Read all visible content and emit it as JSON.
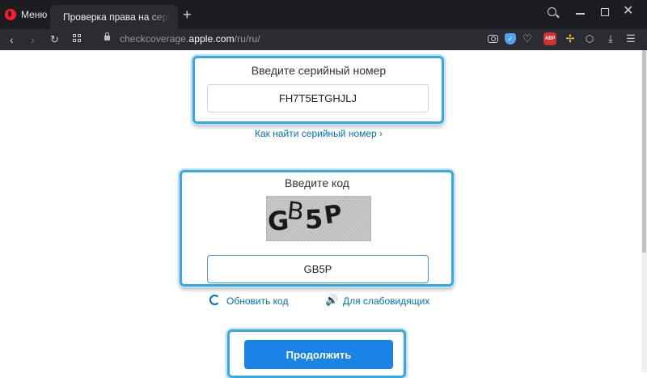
{
  "browser": {
    "menu_label": "Меню",
    "tab_title": "Проверка права на сервисное обслуживание",
    "new_tab_symbol": "+",
    "url_prefix": "checkcoverage.",
    "url_host": "apple.com",
    "url_path": "/ru/ru/"
  },
  "form": {
    "serial_label": "Введите серийный номер",
    "serial_value": "FH7T5ETGHJLJ",
    "find_serial_link": "Как найти серийный номер ›",
    "code_label": "Введите код",
    "captcha_chars": [
      "G",
      "B",
      "5",
      "P"
    ],
    "code_value": "GB5P",
    "refresh_link": "Обновить код",
    "audio_link": "Для слабовидящих",
    "continue_button": "Продолжить"
  },
  "colors": {
    "accent": "#0070c9",
    "button": "#1a84e6",
    "highlight": "#37a8e0"
  }
}
